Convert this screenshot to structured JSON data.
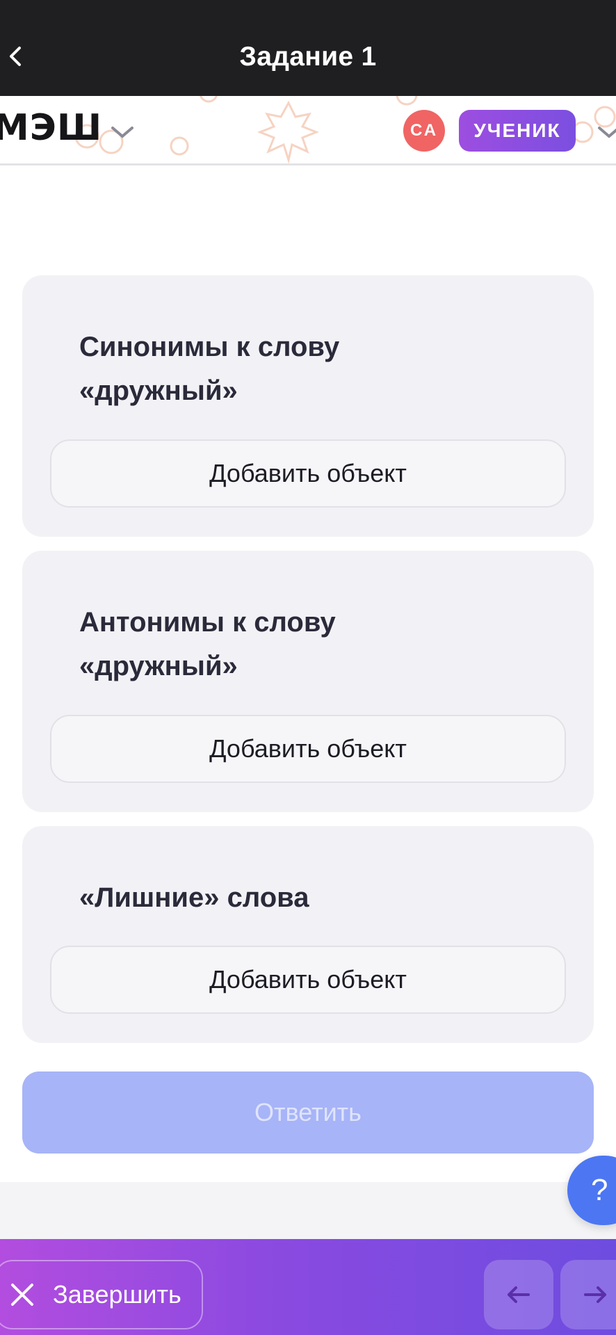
{
  "header": {
    "title": "Задание 1",
    "back_icon": "chevron-left-icon"
  },
  "appbar": {
    "logo": "МЭШ",
    "avatar_initials": "СА",
    "role": "УЧЕНИК"
  },
  "cards": [
    {
      "title_line1": "Синонимы к слову",
      "title_line2": "«дружный»",
      "add_label": "Добавить объект"
    },
    {
      "title_line1": "Антонимы к слову",
      "title_line2": "«дружный»",
      "add_label": "Добавить объект"
    },
    {
      "title_line1": "«Лишние» слова",
      "add_label": "Добавить объект"
    }
  ],
  "answer_label": "Ответить",
  "help_label": "?",
  "bottom": {
    "finish_label": "Завершить"
  },
  "colors": {
    "accent": "#7b4fe0",
    "answer_disabled": "#a7b4f7",
    "avatar": "#f06464",
    "help": "#4d76f3"
  }
}
